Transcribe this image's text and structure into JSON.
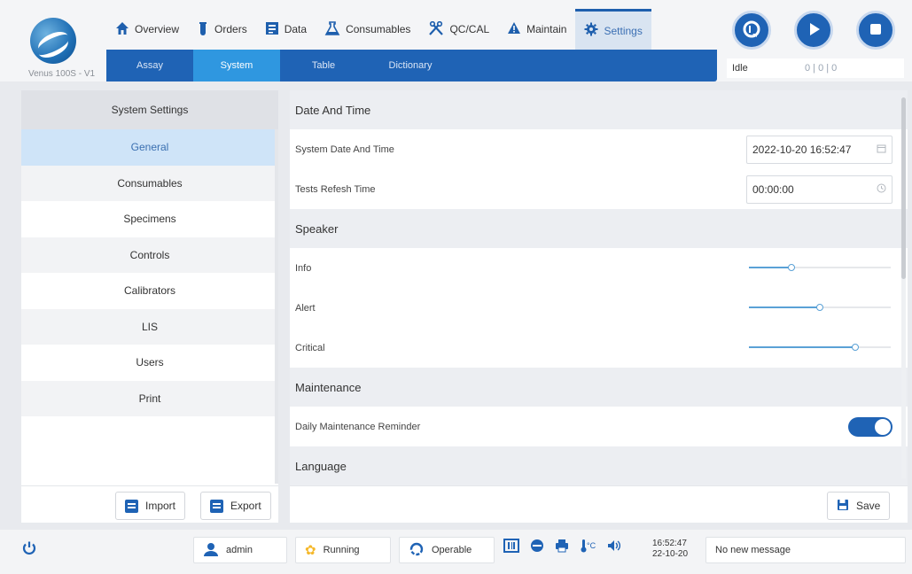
{
  "app": {
    "version": "Venus 100S - V1"
  },
  "nav": {
    "tabs": [
      {
        "label": "Overview",
        "icon": "home-icon"
      },
      {
        "label": "Orders",
        "icon": "test-tube-icon"
      },
      {
        "label": "Data",
        "icon": "data-icon"
      },
      {
        "label": "Consumables",
        "icon": "flask-icon"
      },
      {
        "label": "QC/CAL",
        "icon": "tools-icon"
      },
      {
        "label": "Maintain",
        "icon": "warning-icon"
      },
      {
        "label": "Settings",
        "icon": "gear-icon"
      }
    ],
    "active": "Settings"
  },
  "subnav": {
    "items": [
      "Assay",
      "System",
      "Table",
      "Dictionary"
    ],
    "active": "System"
  },
  "status": {
    "state": "Idle",
    "counts": "0 | 0 | 0"
  },
  "sidebar": {
    "title": "System Settings",
    "items": [
      "General",
      "Consumables",
      "Specimens",
      "Controls",
      "Calibrators",
      "LIS",
      "Users",
      "Print"
    ],
    "active": "General",
    "import_label": "Import",
    "export_label": "Export"
  },
  "settings": {
    "datetime": {
      "header": "Date And Time",
      "system_label": "System Date And Time",
      "system_value": "2022-10-20 16:52:47",
      "refresh_label": "Tests Refesh Time",
      "refresh_value": "00:00:00"
    },
    "speaker": {
      "header": "Speaker",
      "info_label": "Info",
      "info_level": 0.3,
      "alert_label": "Alert",
      "alert_level": 0.5,
      "critical_label": "Critical",
      "critical_level": 0.75
    },
    "maintenance": {
      "header": "Maintenance",
      "daily_label": "Daily Maintenance Reminder",
      "daily_enabled": true
    },
    "language": {
      "header": "Language"
    },
    "save_label": "Save"
  },
  "bottom": {
    "user": "admin",
    "running": "Running",
    "operable": "Operable",
    "time": "16:52:47",
    "date": "22-10-20",
    "message": "No new message"
  },
  "colors": {
    "accent": "#1f63b5",
    "active_tab": "#2f97e0",
    "running": "#f5b82a"
  }
}
